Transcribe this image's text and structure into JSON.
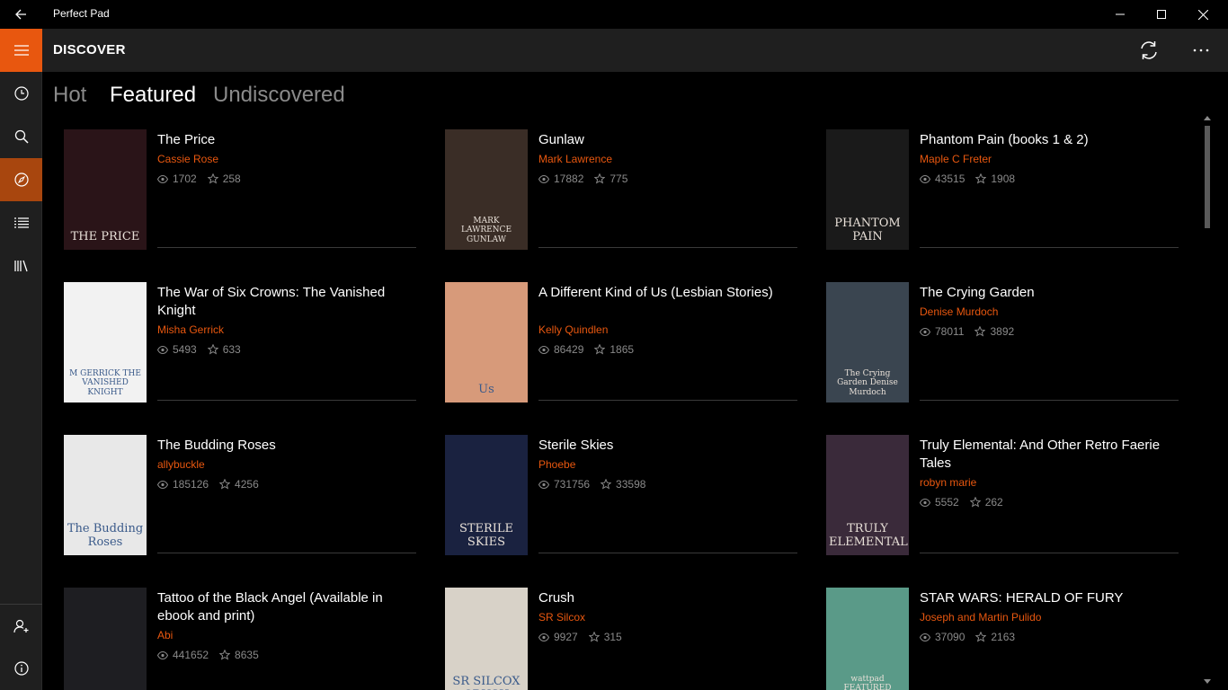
{
  "window": {
    "title": "Perfect Pad"
  },
  "header": {
    "title": "DISCOVER"
  },
  "tabs": [
    {
      "label": "Hot",
      "selected": false
    },
    {
      "label": "Featured",
      "selected": true
    },
    {
      "label": "Undiscovered",
      "selected": false
    }
  ],
  "rail_icons": [
    "menu-icon",
    "clock-icon",
    "search-icon",
    "compass-icon",
    "list-icon",
    "library-icon",
    "add-user-icon",
    "info-icon"
  ],
  "accent_color": "#e8570f",
  "books": [
    {
      "title": "The Price",
      "author": "Cassie Rose",
      "views": "1702",
      "stars": "258",
      "cover_text": "THE PRICE",
      "cover_bg": "#2a1418"
    },
    {
      "title": "Gunlaw",
      "author": "Mark Lawrence",
      "views": "17882",
      "stars": "775",
      "cover_text": "MARK LAWRENCE GUNLAW",
      "cover_bg": "#3a2d26"
    },
    {
      "title": "Phantom Pain (books 1 & 2)",
      "author": "Maple C Freter",
      "views": "43515",
      "stars": "1908",
      "cover_text": "PHANTOM PAIN",
      "cover_bg": "#1a1a1a"
    },
    {
      "title": "The War of Six Crowns: The Vanished Knight",
      "author": "Misha Gerrick",
      "views": "5493",
      "stars": "633",
      "cover_text": "M GERRICK THE VANISHED KNIGHT",
      "cover_bg": "#f2f2f2"
    },
    {
      "title": "A Different Kind of Us (Lesbian Stories)",
      "author": "Kelly Quindlen",
      "views": "86429",
      "stars": "1865",
      "cover_text": "Us",
      "cover_bg": "#d79a7a"
    },
    {
      "title": "The Crying Garden",
      "author": "Denise Murdoch",
      "views": "78011",
      "stars": "3892",
      "cover_text": "The Crying Garden Denise Murdoch",
      "cover_bg": "#3a4550"
    },
    {
      "title": "The Budding Roses",
      "author": "allybuckle",
      "views": "185126",
      "stars": "4256",
      "cover_text": "The Budding Roses",
      "cover_bg": "#e8e8e8"
    },
    {
      "title": "Sterile Skies",
      "author": "Phoebe",
      "views": "731756",
      "stars": "33598",
      "cover_text": "STERILE SKIES",
      "cover_bg": "#1a2240"
    },
    {
      "title": "Truly Elemental: And Other Retro Faerie Tales",
      "author": "robyn marie",
      "views": "5552",
      "stars": "262",
      "cover_text": "TRULY ELEMENTAL",
      "cover_bg": "#3a2a3a"
    },
    {
      "title": "Tattoo of the Black Angel (Available in ebook and print)",
      "author": "Abi",
      "views": "441652",
      "stars": "8635",
      "cover_text": "",
      "cover_bg": "#1e1e22"
    },
    {
      "title": "Crush",
      "author": "SR Silcox",
      "views": "9927",
      "stars": "315",
      "cover_text": "SR SILCOX CRUSH",
      "cover_bg": "#d8d2c8"
    },
    {
      "title": "STAR WARS: HERALD OF FURY",
      "author": "Joseph and Martin Pulido",
      "views": "37090",
      "stars": "2163",
      "cover_text": "wattpad FEATURED STORY",
      "cover_bg": "#5a9a88"
    }
  ]
}
